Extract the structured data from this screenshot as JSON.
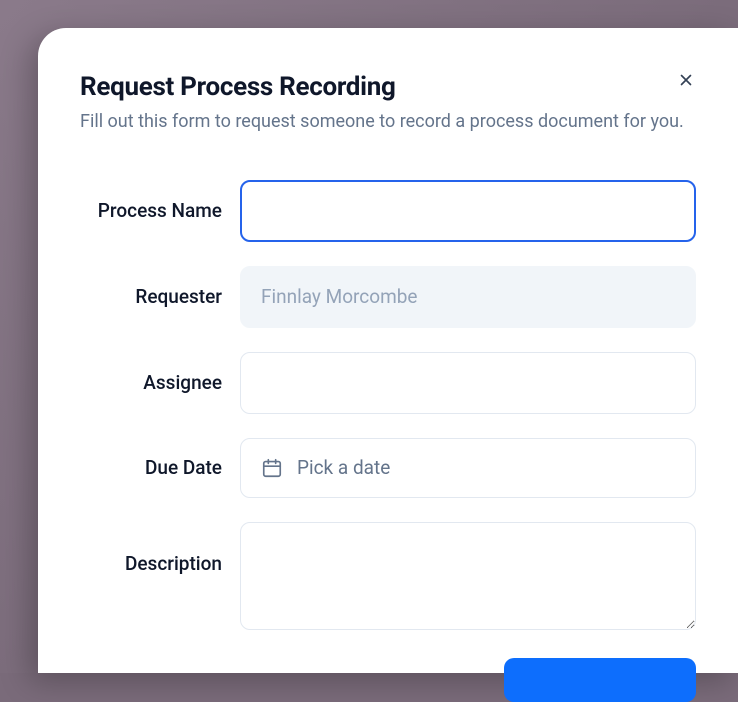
{
  "modal": {
    "title": "Request Process Recording",
    "subtitle": "Fill out this form to request someone to record a process document for you."
  },
  "form": {
    "process_name": {
      "label": "Process Name",
      "value": ""
    },
    "requester": {
      "label": "Requester",
      "value": "Finnlay Morcombe"
    },
    "assignee": {
      "label": "Assignee",
      "value": ""
    },
    "due_date": {
      "label": "Due Date",
      "placeholder": "Pick a date"
    },
    "description": {
      "label": "Description",
      "value": ""
    }
  }
}
